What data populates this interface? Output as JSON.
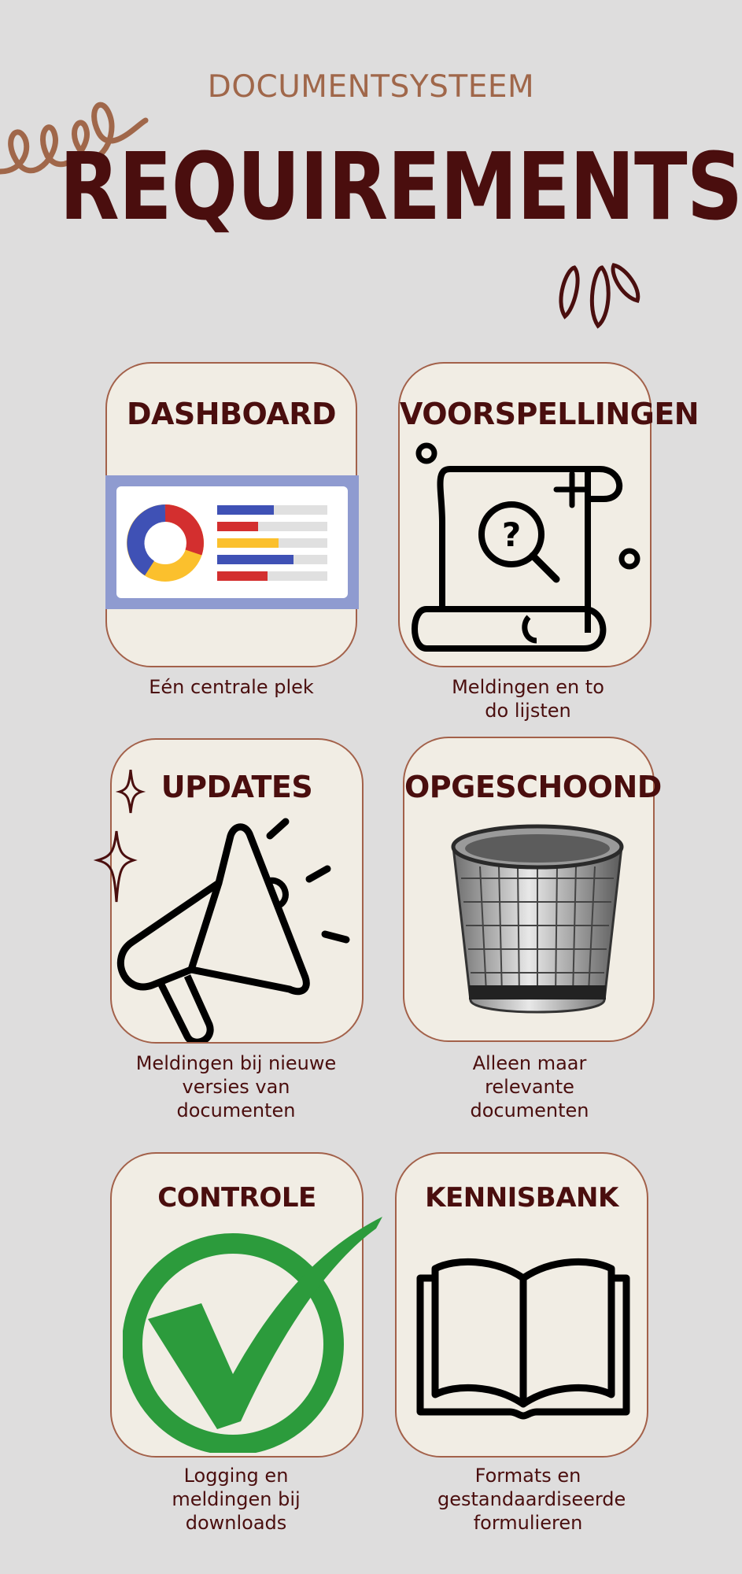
{
  "header": {
    "subtitle": "DOCUMENTSYSTEEM",
    "title": "REQUIREMENTS"
  },
  "cards": [
    {
      "title": "DASHBOARD",
      "caption": "Eén centrale plek",
      "icon": "dashboard-icon"
    },
    {
      "title": "VOORSPELLINGEN",
      "caption": "Meldingen en to do lijsten",
      "icon": "scroll-search-icon"
    },
    {
      "title": "UPDATES",
      "caption": "Meldingen bij nieuwe versies van documenten",
      "icon": "megaphone-icon"
    },
    {
      "title": "OPGESCHOOND",
      "caption": "Alleen maar relevante documenten",
      "icon": "trash-bin-icon"
    },
    {
      "title": "CONTROLE",
      "caption": "Logging en meldingen bij downloads",
      "icon": "checkmark-icon"
    },
    {
      "title": "KENNISBANK",
      "caption": "Formats en gestandaardiseerde formulieren",
      "icon": "book-icon"
    }
  ],
  "colors": {
    "background": "#dedddd",
    "card": "#f1ede4",
    "card_border": "#a3614a",
    "title": "#4a0e0e",
    "subtitle": "#a0674a"
  }
}
